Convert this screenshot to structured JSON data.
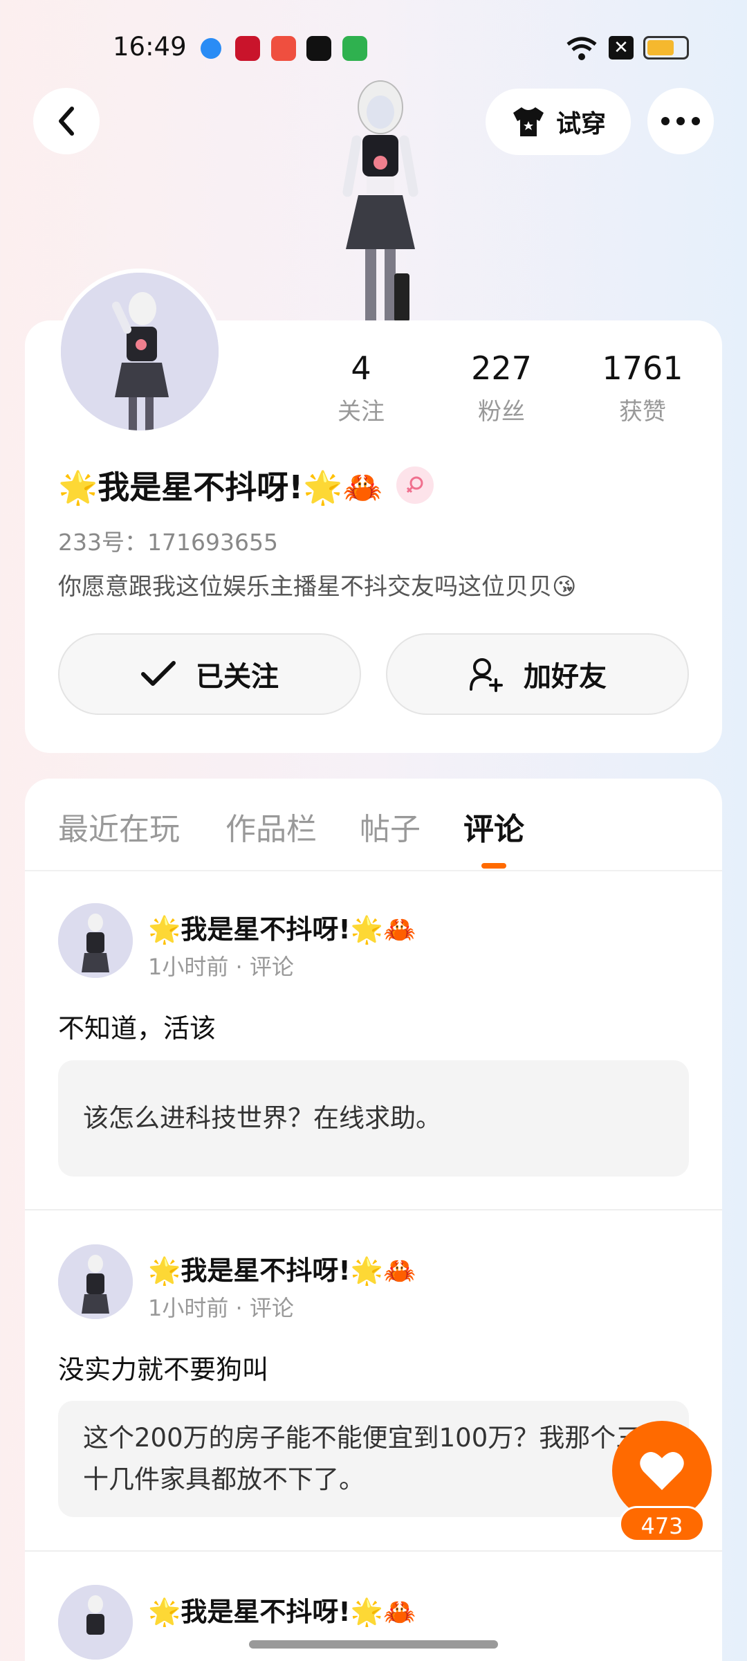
{
  "status_bar": {
    "time": "16:49"
  },
  "header": {
    "tryon_label": "试穿"
  },
  "profile": {
    "nickname": "🌟我是星不抖呀!🌟🦀",
    "uid": "233号：171693655",
    "bio": "你愿意跟我这位娱乐主播星不抖交友吗这位贝贝😘",
    "stats": [
      {
        "num": "4",
        "label": "关注"
      },
      {
        "num": "227",
        "label": "粉丝"
      },
      {
        "num": "1761",
        "label": "获赞"
      }
    ],
    "follow_label": "已关注",
    "add_friend_label": "加好友"
  },
  "tabs": [
    {
      "label": "最近在玩"
    },
    {
      "label": "作品栏"
    },
    {
      "label": "帖子"
    },
    {
      "label": "评论"
    }
  ],
  "comments": [
    {
      "name": "🌟我是星不抖呀!🌟🦀",
      "meta": "1小时前 · 评论",
      "text": "不知道，活该",
      "quote": "该怎么进科技世界？在线求助。"
    },
    {
      "name": "🌟我是星不抖呀!🌟🦀",
      "meta": "1小时前 · 评论",
      "text": "没实力就不要狗叫",
      "quote": "这个200万的房子能不能便宜到100万？我那个三十几件家具都放不下了。"
    },
    {
      "name": "🌟我是星不抖呀!🌟🦀"
    }
  ],
  "like": {
    "count": "473"
  },
  "colors": {
    "accent": "#ff6a00"
  }
}
